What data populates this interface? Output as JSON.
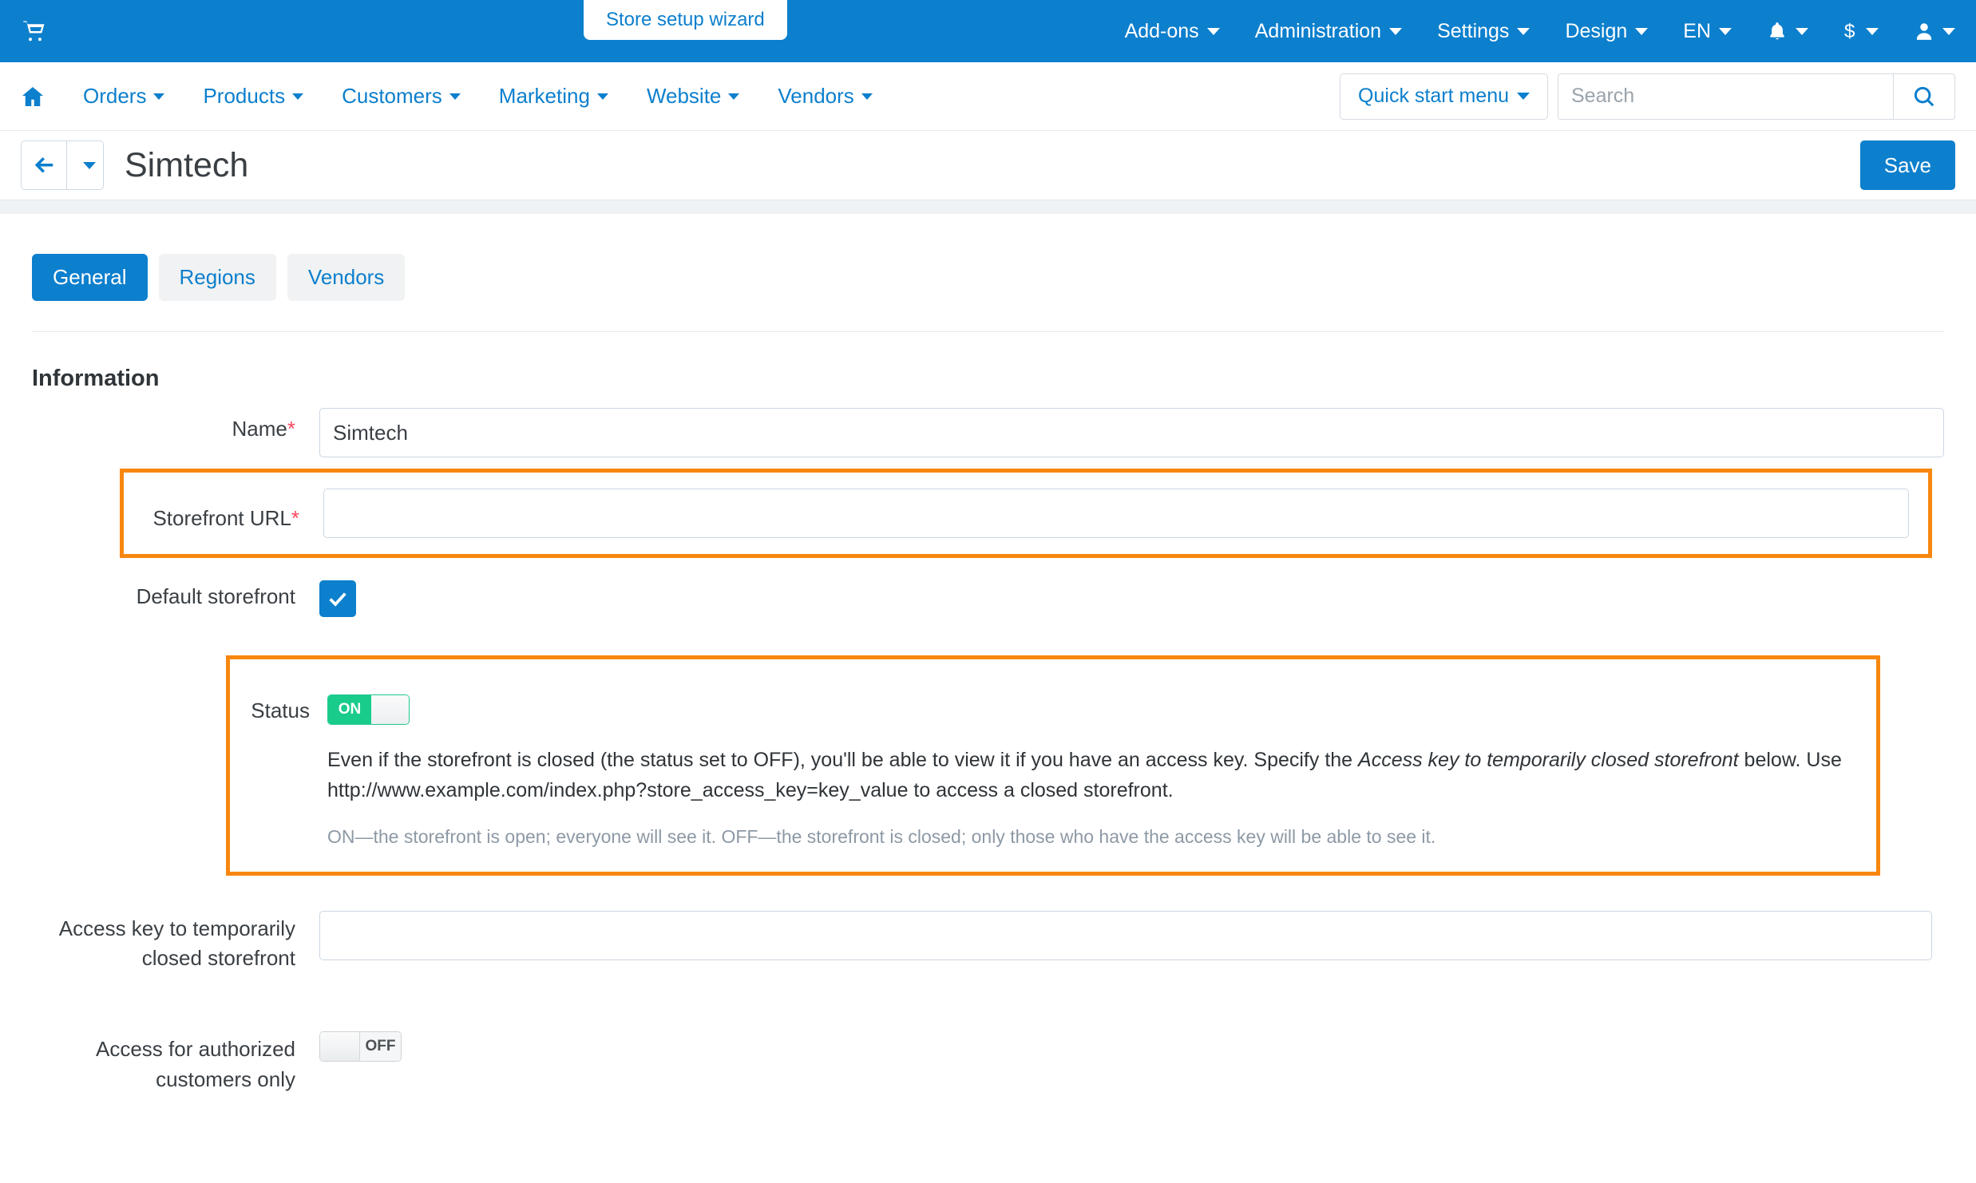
{
  "colors": {
    "brand_blue": "#0c7fcd",
    "highlight_orange": "#f7870f",
    "toggle_green": "#19cc8c",
    "required_red": "#f8485e"
  },
  "topbar": {
    "cart_icon": "cart-icon",
    "setup_wizard_label": "Store setup wizard",
    "menu": [
      {
        "label": "Add-ons",
        "icon": ""
      },
      {
        "label": "Administration",
        "icon": ""
      },
      {
        "label": "Settings",
        "icon": ""
      },
      {
        "label": "Design",
        "icon": ""
      },
      {
        "label": "EN",
        "icon": ""
      }
    ],
    "icon_items": [
      {
        "name": "notifications-bell-icon"
      },
      {
        "name": "currency-dollar-icon"
      },
      {
        "name": "user-account-icon"
      }
    ]
  },
  "subnav": {
    "home_icon": "home-icon",
    "items": [
      {
        "label": "Orders"
      },
      {
        "label": "Products"
      },
      {
        "label": "Customers"
      },
      {
        "label": "Marketing"
      },
      {
        "label": "Website"
      },
      {
        "label": "Vendors"
      }
    ],
    "quick_start_label": "Quick start menu",
    "search_placeholder": "Search",
    "search_value": ""
  },
  "titlebar": {
    "page_title": "Simtech",
    "save_label": "Save"
  },
  "tabs": [
    {
      "label": "General",
      "active": true
    },
    {
      "label": "Regions",
      "active": false
    },
    {
      "label": "Vendors",
      "active": false
    }
  ],
  "form": {
    "section_title": "Information",
    "name": {
      "label": "Name",
      "required": "*",
      "value": "Simtech",
      "placeholder": ""
    },
    "storefront_url": {
      "label": "Storefront URL",
      "required": "*",
      "value": "",
      "placeholder": ""
    },
    "default_storefront": {
      "label": "Default storefront",
      "checked": true
    },
    "status": {
      "label": "Status",
      "toggle_state": "ON",
      "description_part1": "Even if the storefront is closed (the status set to OFF), you'll be able to view it if you have an access key. Specify the ",
      "description_italic": "Access key to temporarily closed storefront",
      "description_part2": " below. Use http://www.example.com/index.php?store_access_key=key_value to access a closed storefront.",
      "hint": "ON—the storefront is open; everyone will see it. OFF—the storefront is closed; only those who have the access key will be able to see it."
    },
    "access_key": {
      "label_line1": "Access key to temporarily",
      "label_line2": "closed storefront",
      "value": "",
      "placeholder": ""
    },
    "authorized_only": {
      "label_line1": "Access for authorized",
      "label_line2": "customers only",
      "toggle_state": "OFF"
    }
  }
}
